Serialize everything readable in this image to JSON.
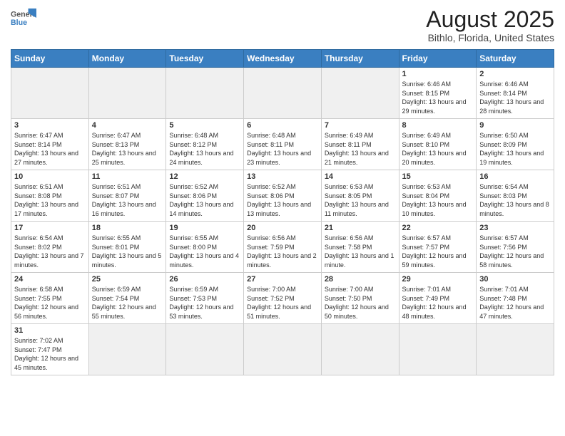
{
  "logo": {
    "text_general": "General",
    "text_blue": "Blue"
  },
  "header": {
    "title": "August 2025",
    "subtitle": "Bithlo, Florida, United States"
  },
  "days_of_week": [
    "Sunday",
    "Monday",
    "Tuesday",
    "Wednesday",
    "Thursday",
    "Friday",
    "Saturday"
  ],
  "weeks": [
    [
      {
        "day": "",
        "info": ""
      },
      {
        "day": "",
        "info": ""
      },
      {
        "day": "",
        "info": ""
      },
      {
        "day": "",
        "info": ""
      },
      {
        "day": "",
        "info": ""
      },
      {
        "day": "1",
        "info": "Sunrise: 6:46 AM\nSunset: 8:15 PM\nDaylight: 13 hours and 29 minutes."
      },
      {
        "day": "2",
        "info": "Sunrise: 6:46 AM\nSunset: 8:14 PM\nDaylight: 13 hours and 28 minutes."
      }
    ],
    [
      {
        "day": "3",
        "info": "Sunrise: 6:47 AM\nSunset: 8:14 PM\nDaylight: 13 hours and 27 minutes."
      },
      {
        "day": "4",
        "info": "Sunrise: 6:47 AM\nSunset: 8:13 PM\nDaylight: 13 hours and 25 minutes."
      },
      {
        "day": "5",
        "info": "Sunrise: 6:48 AM\nSunset: 8:12 PM\nDaylight: 13 hours and 24 minutes."
      },
      {
        "day": "6",
        "info": "Sunrise: 6:48 AM\nSunset: 8:11 PM\nDaylight: 13 hours and 23 minutes."
      },
      {
        "day": "7",
        "info": "Sunrise: 6:49 AM\nSunset: 8:11 PM\nDaylight: 13 hours and 21 minutes."
      },
      {
        "day": "8",
        "info": "Sunrise: 6:49 AM\nSunset: 8:10 PM\nDaylight: 13 hours and 20 minutes."
      },
      {
        "day": "9",
        "info": "Sunrise: 6:50 AM\nSunset: 8:09 PM\nDaylight: 13 hours and 19 minutes."
      }
    ],
    [
      {
        "day": "10",
        "info": "Sunrise: 6:51 AM\nSunset: 8:08 PM\nDaylight: 13 hours and 17 minutes."
      },
      {
        "day": "11",
        "info": "Sunrise: 6:51 AM\nSunset: 8:07 PM\nDaylight: 13 hours and 16 minutes."
      },
      {
        "day": "12",
        "info": "Sunrise: 6:52 AM\nSunset: 8:06 PM\nDaylight: 13 hours and 14 minutes."
      },
      {
        "day": "13",
        "info": "Sunrise: 6:52 AM\nSunset: 8:06 PM\nDaylight: 13 hours and 13 minutes."
      },
      {
        "day": "14",
        "info": "Sunrise: 6:53 AM\nSunset: 8:05 PM\nDaylight: 13 hours and 11 minutes."
      },
      {
        "day": "15",
        "info": "Sunrise: 6:53 AM\nSunset: 8:04 PM\nDaylight: 13 hours and 10 minutes."
      },
      {
        "day": "16",
        "info": "Sunrise: 6:54 AM\nSunset: 8:03 PM\nDaylight: 13 hours and 8 minutes."
      }
    ],
    [
      {
        "day": "17",
        "info": "Sunrise: 6:54 AM\nSunset: 8:02 PM\nDaylight: 13 hours and 7 minutes."
      },
      {
        "day": "18",
        "info": "Sunrise: 6:55 AM\nSunset: 8:01 PM\nDaylight: 13 hours and 5 minutes."
      },
      {
        "day": "19",
        "info": "Sunrise: 6:55 AM\nSunset: 8:00 PM\nDaylight: 13 hours and 4 minutes."
      },
      {
        "day": "20",
        "info": "Sunrise: 6:56 AM\nSunset: 7:59 PM\nDaylight: 13 hours and 2 minutes."
      },
      {
        "day": "21",
        "info": "Sunrise: 6:56 AM\nSunset: 7:58 PM\nDaylight: 13 hours and 1 minute."
      },
      {
        "day": "22",
        "info": "Sunrise: 6:57 AM\nSunset: 7:57 PM\nDaylight: 12 hours and 59 minutes."
      },
      {
        "day": "23",
        "info": "Sunrise: 6:57 AM\nSunset: 7:56 PM\nDaylight: 12 hours and 58 minutes."
      }
    ],
    [
      {
        "day": "24",
        "info": "Sunrise: 6:58 AM\nSunset: 7:55 PM\nDaylight: 12 hours and 56 minutes."
      },
      {
        "day": "25",
        "info": "Sunrise: 6:59 AM\nSunset: 7:54 PM\nDaylight: 12 hours and 55 minutes."
      },
      {
        "day": "26",
        "info": "Sunrise: 6:59 AM\nSunset: 7:53 PM\nDaylight: 12 hours and 53 minutes."
      },
      {
        "day": "27",
        "info": "Sunrise: 7:00 AM\nSunset: 7:52 PM\nDaylight: 12 hours and 51 minutes."
      },
      {
        "day": "28",
        "info": "Sunrise: 7:00 AM\nSunset: 7:50 PM\nDaylight: 12 hours and 50 minutes."
      },
      {
        "day": "29",
        "info": "Sunrise: 7:01 AM\nSunset: 7:49 PM\nDaylight: 12 hours and 48 minutes."
      },
      {
        "day": "30",
        "info": "Sunrise: 7:01 AM\nSunset: 7:48 PM\nDaylight: 12 hours and 47 minutes."
      }
    ],
    [
      {
        "day": "31",
        "info": "Sunrise: 7:02 AM\nSunset: 7:47 PM\nDaylight: 12 hours and 45 minutes."
      },
      {
        "day": "",
        "info": ""
      },
      {
        "day": "",
        "info": ""
      },
      {
        "day": "",
        "info": ""
      },
      {
        "day": "",
        "info": ""
      },
      {
        "day": "",
        "info": ""
      },
      {
        "day": "",
        "info": ""
      }
    ]
  ]
}
